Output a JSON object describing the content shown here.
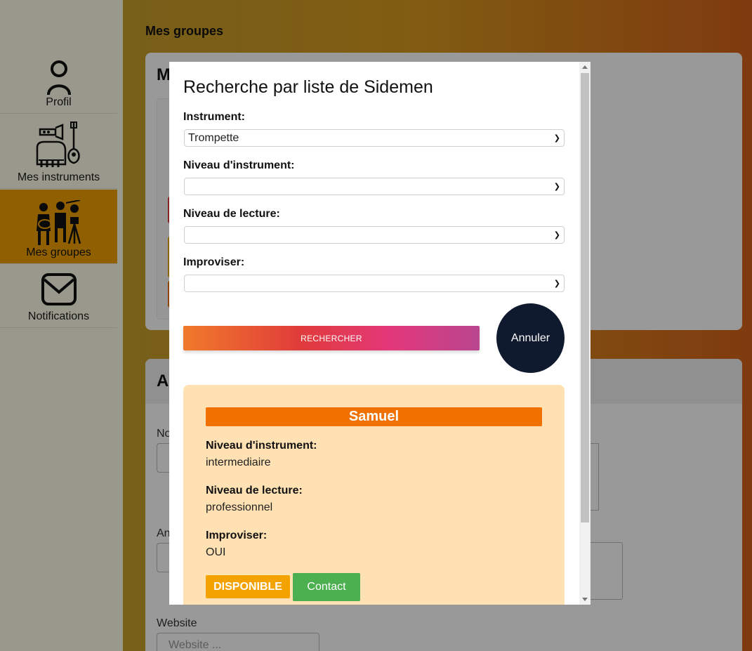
{
  "sidebar": {
    "items": [
      {
        "label": "Profil",
        "icon": "person-icon"
      },
      {
        "label": "Mes instruments",
        "icon": "instruments-icon"
      },
      {
        "label": "Mes groupes",
        "icon": "band-icon",
        "active": true
      },
      {
        "label": "Notifications",
        "icon": "envelope-icon"
      }
    ]
  },
  "main": {
    "page_title": "Mes groupes",
    "card1_head": "M",
    "card2_head": "A",
    "field_website_label": "Website",
    "field_website_placeholder": "Website ...",
    "field_no_label": "No",
    "field_an_label": "An"
  },
  "modal": {
    "title": "Recherche par liste de Sidemen",
    "filters": [
      {
        "label": "Instrument:",
        "value": "Trompette"
      },
      {
        "label": "Niveau d'instrument:",
        "value": ""
      },
      {
        "label": "Niveau de lecture:",
        "value": ""
      },
      {
        "label": "Improviser:",
        "value": ""
      }
    ],
    "search_button": "RECHERCHER",
    "cancel_button": "Annuler",
    "result": {
      "name": "Samuel",
      "instrument_level_label": "Niveau d'instrument:",
      "instrument_level": "intermediaire",
      "reading_level_label": "Niveau de lecture:",
      "reading_level": "professionnel",
      "improvise_label": "Improviser:",
      "improvise": "OUI",
      "status_badge": "DISPONIBLE",
      "contact_button": "Contact"
    }
  },
  "colors": {
    "accent_orange": "#f07000",
    "badge_orange": "#f4a200",
    "contact_green": "#4caf50",
    "cancel_navy": "#0f1a2e",
    "result_bg": "#ffe1b3"
  }
}
